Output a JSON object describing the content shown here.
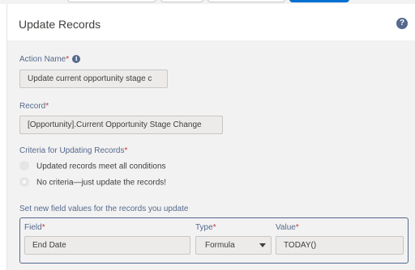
{
  "header": {
    "title": "Update Records"
  },
  "action_name": {
    "label": "Action Name",
    "required": "*",
    "value": "Update current opportunity stage c"
  },
  "record": {
    "label": "Record",
    "required": "*",
    "value": "[Opportunity].Current Opportunity Stage Change"
  },
  "criteria": {
    "label": "Criteria for Updating Records",
    "required": "*",
    "options": [
      {
        "label": "Updated records meet all conditions",
        "selected": false
      },
      {
        "label": "No criteria—just update the records!",
        "selected": true
      }
    ]
  },
  "field_values": {
    "label": "Set new field values for the records you update",
    "field_label": "Field",
    "type_label": "Type",
    "value_label": "Value",
    "required": "*",
    "row": {
      "field": "End Date",
      "type": "Formula",
      "value": "TODAY()"
    }
  },
  "icons": {
    "help": "question-circle-icon",
    "info": "info-icon",
    "dropdown": "chevron-down-icon"
  },
  "colors": {
    "label": "#54698d",
    "required": "#c23934",
    "primary": "#0070d2",
    "panel": "#f3f2f2"
  }
}
